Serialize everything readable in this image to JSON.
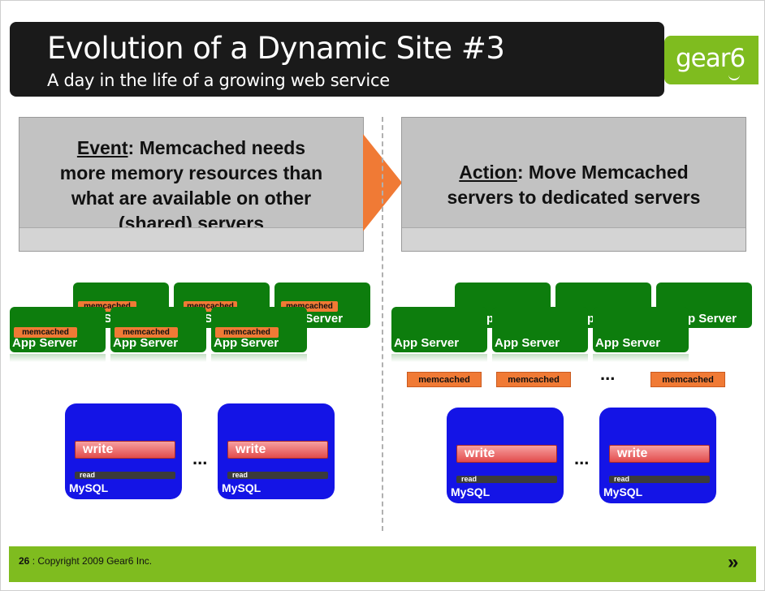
{
  "header": {
    "title": "Evolution of a Dynamic Site #3",
    "subtitle": "A day in the life of a growing web service",
    "logo": "gear6"
  },
  "event_box": {
    "label": "Event",
    "text_line1": ": Memcached needs",
    "text_line2": "more memory resources than",
    "text_line3": "what are available on other",
    "text_line4": "(shared) servers"
  },
  "action_box": {
    "label": "Action",
    "text_line1": ": Move Memcached",
    "text_line2": "servers to dedicated servers"
  },
  "left_diagram": {
    "app_server_label": "App Server",
    "memcached_tag": "memcached",
    "mysql_label": "MySQL",
    "write_label": "write",
    "read_label": "read",
    "ellipsis": "..."
  },
  "right_diagram": {
    "app_server_label": "App Server",
    "memcached_label": "memcached",
    "mysql_label": "MySQL",
    "write_label": "write",
    "read_label": "read",
    "ellipsis": "..."
  },
  "footer": {
    "page_number": "26",
    "copyright": " : Copyright 2009 Gear6 Inc.",
    "next_glyph": "»"
  },
  "colors": {
    "header_bg": "#1a1a1a",
    "brand_green": "#7fbc1f",
    "server_green": "#0d7d0d",
    "memcached_orange": "#f07a35",
    "mysql_blue": "#1414e6",
    "write_red": "#e24c4c"
  }
}
